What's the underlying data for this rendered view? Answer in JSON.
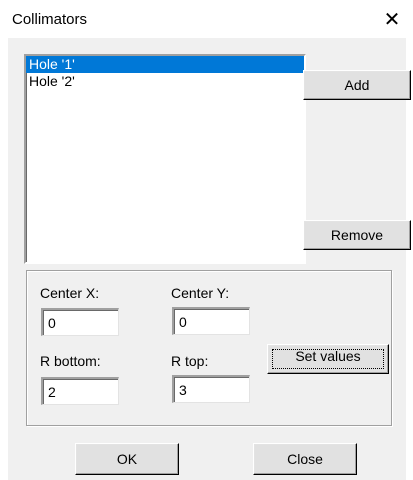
{
  "window": {
    "title": "Collimators",
    "close_glyph": "✕"
  },
  "collimators_list": {
    "items": [
      "Hole '1'",
      "Hole '2'"
    ],
    "selected_index": 0
  },
  "buttons": {
    "add": "Add",
    "remove": "Remove",
    "set_values": "Set values",
    "ok": "OK",
    "close": "Close"
  },
  "params": {
    "center_x_label": "Center X:",
    "center_x_value": "0",
    "center_y_label": "Center Y:",
    "center_y_value": "0",
    "r_bottom_label": "R bottom:",
    "r_bottom_value": "2",
    "r_top_label": "R top:",
    "r_top_value": "3"
  },
  "colors": {
    "selection": "#0078d7",
    "dialog_bg": "#f0f0f0",
    "button_face": "#e1e1e1"
  }
}
